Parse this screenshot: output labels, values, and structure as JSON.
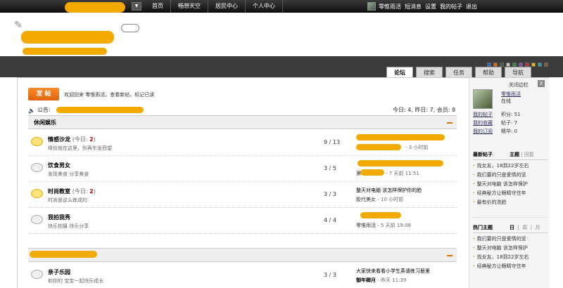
{
  "topbar": {
    "nav": [
      "首页",
      "畅想天空",
      "居民中心",
      "个人中心"
    ],
    "user_links": [
      "零惟雨活",
      "短消息",
      "设置",
      "我的帖子",
      "退出"
    ]
  },
  "tabs": [
    "论坛",
    "搜索",
    "任务",
    "帮助",
    "导航"
  ],
  "swatches": [
    "#2d6bbf",
    "#e07000",
    "#555555",
    "#cccccc",
    "#3c8f3c",
    "#8a4fb0",
    "#c03030",
    "#e0c000",
    "#30a0a0",
    "#806040"
  ],
  "toolbar": {
    "post_button": "发 帖",
    "welcome": "欢迎回来 零惟雨活，查看新帖，标记已读",
    "notice_label": "公告:",
    "stats": "今日: 4, 昨日: 7, 会员: 8"
  },
  "categories": [
    {
      "title": "休闲娱乐",
      "forums": [
        {
          "name": "情感沙龙",
          "today": "2",
          "desc": "缘份就在这里，别再东张西望",
          "count": "9 / 13",
          "last_title": "",
          "last_by": "",
          "last_time": "3 小时前",
          "active": true
        },
        {
          "name": "饮食男女",
          "today": "",
          "desc": "发现美食 分享美食",
          "count": "3 / 5",
          "last_title": "",
          "last_by": "第",
          "last_time": "7 天前 11:51",
          "active": false
        },
        {
          "name": "时尚教室",
          "today": "2",
          "desc": "时尚是这么炼成的",
          "count": "3 / 3",
          "last_title": "整天对电脑 该怎样保护你的脸",
          "last_by": "胶代美女",
          "last_time": "10 小时前",
          "active": true
        },
        {
          "name": "我拍我秀",
          "today": "",
          "desc": "快乐拍摄 快乐分享",
          "count": "4 / 4",
          "last_title": "",
          "last_by": "零惟雨活",
          "last_time": "5 天前 19:06",
          "active": false
        }
      ]
    },
    {
      "title": "",
      "forums": [
        {
          "name": "亲子乐园",
          "today": "",
          "desc": "和你的 宝宝一起快乐成长",
          "count": "3 / 3",
          "last_title": "大家快来看看小学生英语练习册里",
          "last_by": "御年卿月",
          "last_time": "昨天 11:39",
          "active": false
        }
      ]
    }
  ],
  "sidebar": {
    "close_label": "关闭边栏",
    "close_x": "X",
    "username": "零惟雨活",
    "status": "在线",
    "links": [
      "我的帖子",
      "我的收藏",
      "我的订阅"
    ],
    "stats": [
      "积分: 51",
      "帖子: 7",
      "精华: 0"
    ],
    "new_topics_title": "最新帖子",
    "new_topics_tabs": [
      "主题",
      "回复"
    ],
    "new_topics": [
      "找女友，18到22岁左右",
      "我们要的只是爱情的坚",
      "整天对电脑 该怎样保护",
      "经典秘方让眼睛守住年",
      "最有价的洗脸"
    ],
    "hot_title": "热门主题",
    "hot_tabs": [
      "日",
      "周",
      "月"
    ],
    "hot_topics": [
      "我们要的只是爱情的坚",
      "整天对电脑 该怎样保护",
      "找女友，18到22岁左右",
      "经典秘方让眼睛守住年"
    ]
  }
}
